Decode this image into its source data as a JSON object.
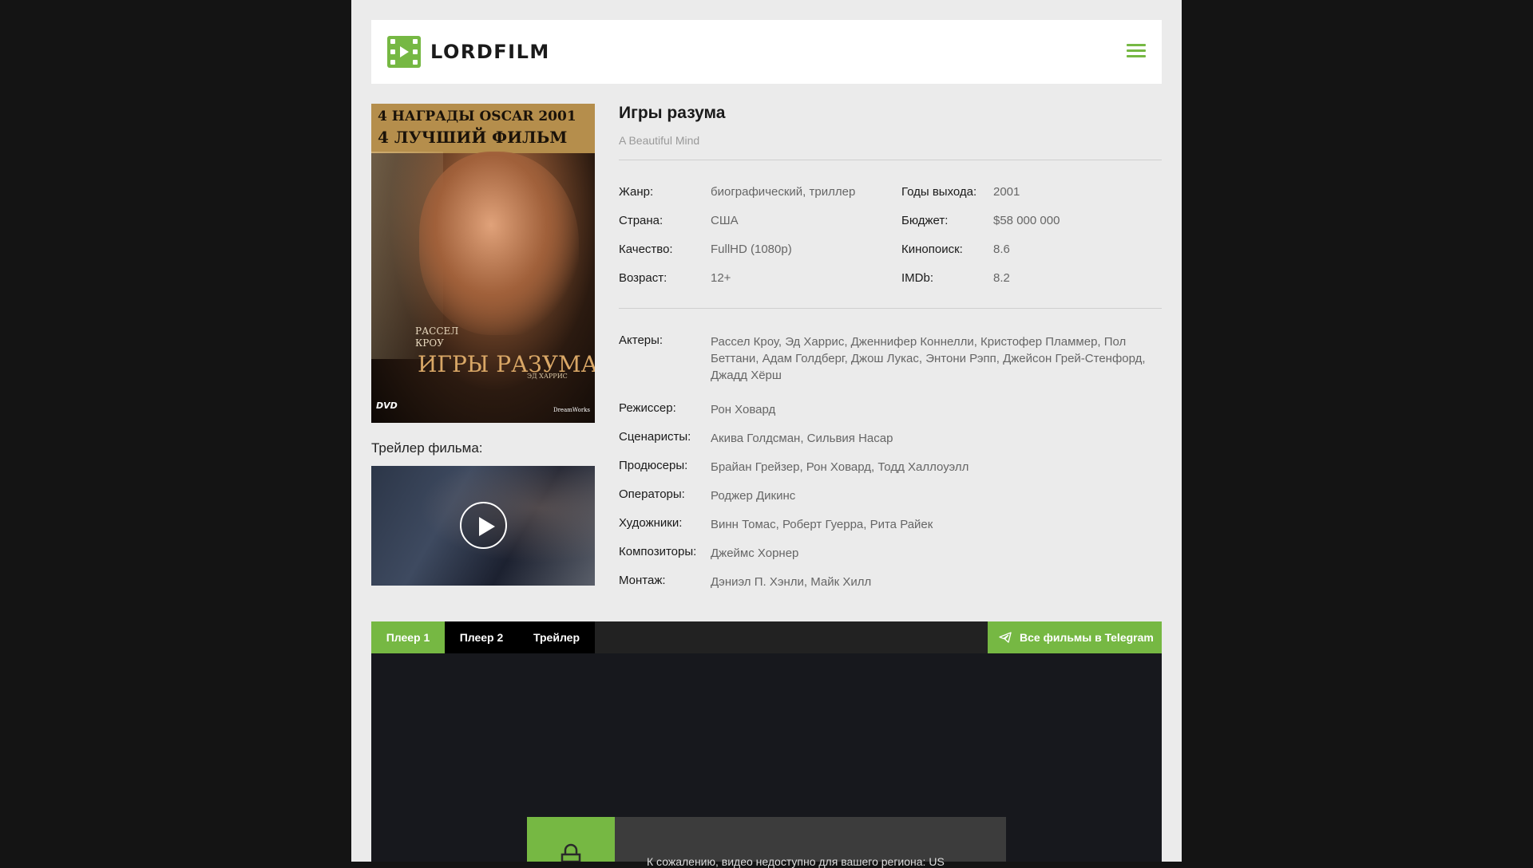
{
  "header": {
    "logo_text": "LORDFILM",
    "menu_icon": "hamburger-icon"
  },
  "poster": {
    "line1": "4 НАГРАДЫ OSCAR 2001",
    "line2": "4 ЛУЧШИЙ ФИЛЬМ",
    "actor_first": "РАССЕЛ",
    "actor_last": "КРОУ",
    "title": "ИГРЫ РАЗУМА",
    "small": "ЭД ХАРРИС",
    "dvd": "DVD",
    "studio": "DreamWorks"
  },
  "trailer": {
    "label": "Трейлер фильма:",
    "play_icon": "play-icon"
  },
  "movie": {
    "title": "Игры разума",
    "original_title": "A Beautiful Mind"
  },
  "details_left": [
    {
      "label": "Жанр:",
      "value": "биографический, триллер"
    },
    {
      "label": "Страна:",
      "value": "США"
    },
    {
      "label": "Качество:",
      "value": "FullHD (1080p)"
    },
    {
      "label": "Возраст:",
      "value": "12+"
    }
  ],
  "details_right": [
    {
      "label": "Годы выхода:",
      "value": "2001"
    },
    {
      "label": "Бюджет:",
      "value": "$58 000 000"
    },
    {
      "label": "Кинопоиск:",
      "value": "8.6"
    },
    {
      "label": "IMDb:",
      "value": "8.2"
    }
  ],
  "crew": [
    {
      "label": "Актеры:",
      "value": "Рассел Кроу, Эд Харрис, Дженнифер Коннелли, Кристофер Пламмер, Пол Беттани, Адам Голдберг, Джош Лукас, Энтони Рэпп, Джейсон Грей-Стенфорд, Джадд Хёрш"
    },
    {
      "label": "Режиссер:",
      "value": "Рон Ховард"
    },
    {
      "label": "Сценаристы:",
      "value": "Акива Голдсман, Сильвия Насар"
    },
    {
      "label": "Продюсеры:",
      "value": "Брайан Грейзер, Рон Ховард, Тодд Халлоуэлл"
    },
    {
      "label": "Операторы:",
      "value": "Роджер Дикинс"
    },
    {
      "label": "Художники:",
      "value": "Винн Томас, Роберт Гуерра, Рита Райек"
    },
    {
      "label": "Композиторы:",
      "value": "Джеймс Хорнер"
    },
    {
      "label": "Монтаж:",
      "value": "Дэниэл П. Хэнли, Майк Хилл"
    }
  ],
  "player": {
    "tabs": [
      {
        "label": "Плеер 1",
        "active": true
      },
      {
        "label": "Плеер 2",
        "active": false
      },
      {
        "label": "Трейлер",
        "active": false
      }
    ],
    "telegram_label": "Все фильмы в Telegram",
    "telegram_icon": "telegram-plane-icon",
    "lock_icon": "lock-icon",
    "notice": "К сожалению, видео недоступно для вашего региона: US"
  },
  "colors": {
    "accent": "#76b843",
    "page_bg": "#ebebeb",
    "outer_bg": "#141414",
    "player_bg": "#17181d"
  }
}
